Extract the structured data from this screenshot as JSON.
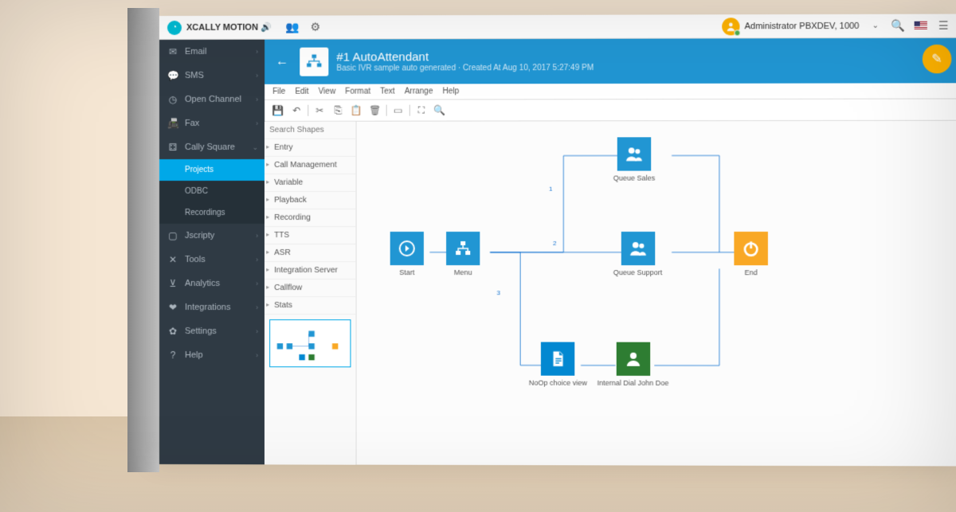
{
  "header": {
    "app_title": "XCALLY MOTION",
    "user_label": "Administrator PBXDEV, 1000"
  },
  "sidebar": {
    "items": [
      {
        "icon": "✉",
        "label": "Email"
      },
      {
        "icon": "💬",
        "label": "SMS"
      },
      {
        "icon": "◷",
        "label": "Open Channel"
      },
      {
        "icon": "📠",
        "label": "Fax"
      },
      {
        "icon": "⚙",
        "label": "Cally Square",
        "expanded": true
      },
      {
        "icon": "▢",
        "label": "Jscripty"
      },
      {
        "icon": "✕",
        "label": "Tools"
      },
      {
        "icon": "⊻",
        "label": "Analytics"
      },
      {
        "icon": "❤",
        "label": "Integrations"
      },
      {
        "icon": "✿",
        "label": "Settings"
      },
      {
        "icon": "?",
        "label": "Help"
      }
    ],
    "sub": [
      {
        "label": "Projects",
        "active": true
      },
      {
        "label": "ODBC"
      },
      {
        "label": "Recordings"
      }
    ]
  },
  "banner": {
    "title": "#1 AutoAttendant",
    "subtitle": "Basic IVR sample auto generated · Created At Aug 10, 2017 5:27:49 PM"
  },
  "menubar": [
    "File",
    "Edit",
    "View",
    "Format",
    "Text",
    "Arrange",
    "Help"
  ],
  "palette": {
    "search_placeholder": "Search Shapes",
    "categories": [
      "Entry",
      "Call Management",
      "Variable",
      "Playback",
      "Recording",
      "TTS",
      "ASR",
      "Integration Server",
      "Callflow",
      "Stats"
    ]
  },
  "nodes": {
    "start": "Start",
    "menu": "Menu",
    "queue_sales": "Queue Sales",
    "queue_support": "Queue Support",
    "end": "End",
    "noop": "NoOp choice view",
    "internal": "Internal Dial John Doe"
  },
  "edges": {
    "e1": "1",
    "e2": "2",
    "e3": "3"
  }
}
